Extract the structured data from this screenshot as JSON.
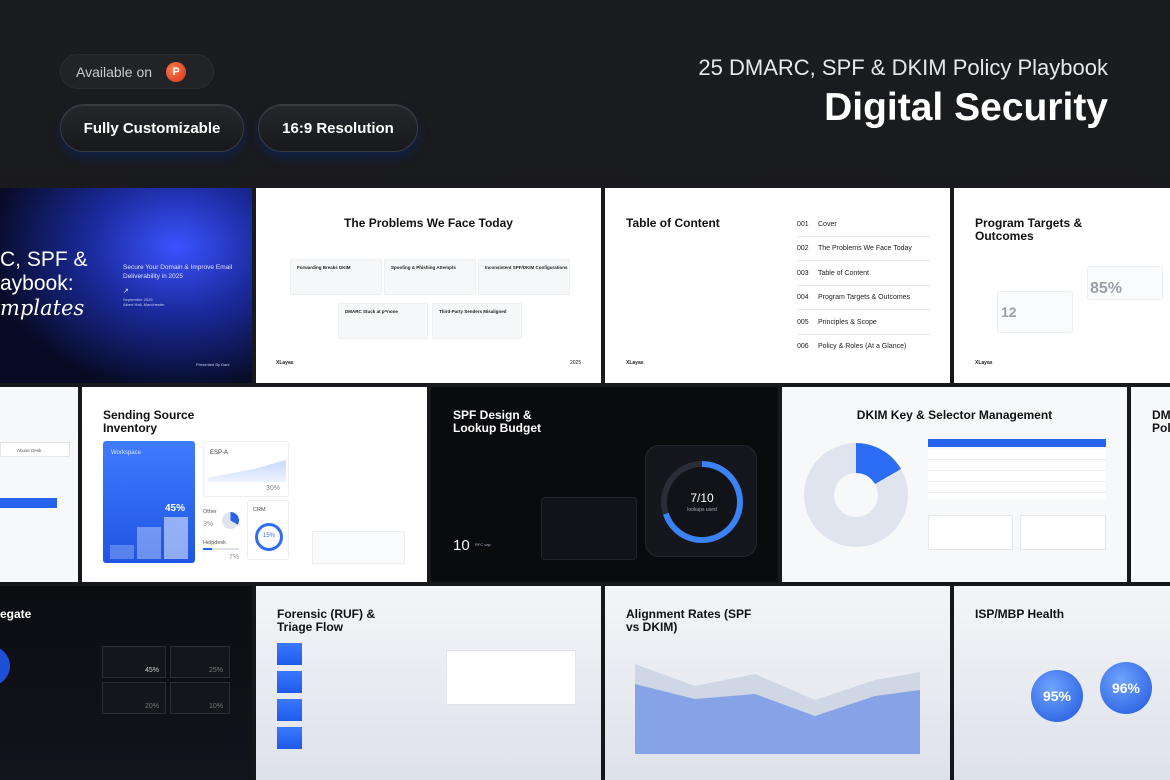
{
  "header": {
    "available_label": "Available on",
    "ppt_icon_letter": "P",
    "btn_customizable": "Fully Customizable",
    "btn_resolution": "16:9 Resolution",
    "subtitle": "25 DMARC, SPF & DKIM Policy Playbook",
    "title": "Digital Security"
  },
  "colors": {
    "accent": "#2563eb",
    "background": "#1b1c1f",
    "slide_dark": "#0a0b0f"
  },
  "slides": {
    "cover": {
      "title_line1": "C, SPF &",
      "title_line2": "aybook:",
      "title_line3": "mplates",
      "tagline": "Secure Your Domain & Improve Email Deliverability in 2025",
      "date": "September 2025",
      "location": "Albert Hall, Manchester",
      "presenter": "Presented By Dani"
    },
    "problems": {
      "title": "The Problems We Face Today",
      "cards": [
        "Forwarding Breaks DKIM",
        "Spoofing & Phishing Attempts",
        "Inconsistent SPF/DKIM Configurations",
        "DMARC Stuck at p=none",
        "Third-Party Senders Misaligned"
      ],
      "logo": "XLayas",
      "year": "2025"
    },
    "toc": {
      "title": "Table of Content",
      "items": [
        {
          "num": "001",
          "label": "Cover"
        },
        {
          "num": "002",
          "label": "The Problems We Face Today"
        },
        {
          "num": "003",
          "label": "Table of Content"
        },
        {
          "num": "004",
          "label": "Program Targets & Outcomes"
        },
        {
          "num": "005",
          "label": "Principles & Scope"
        },
        {
          "num": "006",
          "label": "Policy & Roles (At a Glance)"
        }
      ],
      "logo": "XLayas"
    },
    "targets": {
      "title": "Program Targets & Outcomes",
      "stat1": "85%",
      "stat2": "12",
      "logo": "XLayas"
    },
    "abuse": {
      "label": "Abuse Desk"
    },
    "sending": {
      "title": "Sending Source Inventory",
      "workspace_label": "Workspace",
      "workspace_value": "45%",
      "espa_label": "ESP-A",
      "espa_value": "30%",
      "other_label": "Other",
      "other_value": "3%",
      "crm_label": "CRM",
      "crm_value": "15%",
      "helpdesk_label": "Helpdesk",
      "helpdesk_value": "7%"
    },
    "spf": {
      "title": "SPF Design & Lookup Budget",
      "gauge_value": "7/10",
      "gauge_label": "lookups used",
      "cap_value": "10",
      "cap_label": "RFC cap"
    },
    "dkim": {
      "title": "DKIM Key & Selector Management"
    },
    "dm_partial": {
      "title_line1": "DM",
      "title_line2": "Pol"
    },
    "aggregate": {
      "title": "egate",
      "values": [
        "45%",
        "25%",
        "20%",
        "10%"
      ]
    },
    "forensic": {
      "title": "Forensic (RUF) & Triage Flow"
    },
    "alignment": {
      "title": "Alignment Rates (SPF vs DKIM)"
    },
    "isp": {
      "title": "ISP/MBP Health",
      "stat1": "95%",
      "stat2": "96%"
    }
  }
}
